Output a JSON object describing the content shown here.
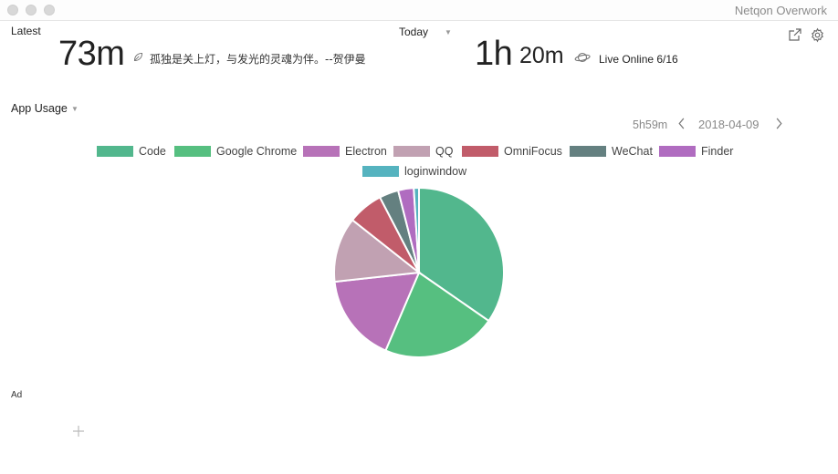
{
  "window": {
    "title": "Netqon Overwork"
  },
  "latest": {
    "label": "Latest",
    "value": "73m",
    "quote": "孤独是关上灯，与发光的灵魂为伴。--贺伊曼"
  },
  "today": {
    "label": "Today",
    "value_hours": "1h",
    "value_minutes": "20m",
    "live_online": "Live Online 6/16"
  },
  "app_usage": {
    "label": "App Usage",
    "total": "5h59m",
    "date": "2018-04-09"
  },
  "ad": {
    "label": "Ad",
    "add_icon": "plus-icon"
  },
  "icons": {
    "export": "external-link-icon",
    "settings": "gear-icon",
    "latest": "leaf-icon",
    "today": "planet-icon",
    "prev": "chevron-left-icon",
    "next": "chevron-right-icon"
  },
  "chart_data": {
    "type": "pie",
    "title": "",
    "legend_position": "top",
    "slices": [
      {
        "name": "Code",
        "value": 35.0,
        "color": "#52b78d"
      },
      {
        "name": "Google Chrome",
        "value": 22.0,
        "color": "#56bf80"
      },
      {
        "name": "Electron",
        "value": 17.0,
        "color": "#b772b8"
      },
      {
        "name": "QQ",
        "value": 12.5,
        "color": "#c1a1b2"
      },
      {
        "name": "OmniFocus",
        "value": 6.8,
        "color": "#c15c6a"
      },
      {
        "name": "WeChat",
        "value": 3.7,
        "color": "#648080"
      },
      {
        "name": "Finder",
        "value": 3.0,
        "color": "#b06cc0"
      },
      {
        "name": "loginwindow",
        "value": 1.0,
        "color": "#55b3bf"
      }
    ]
  }
}
